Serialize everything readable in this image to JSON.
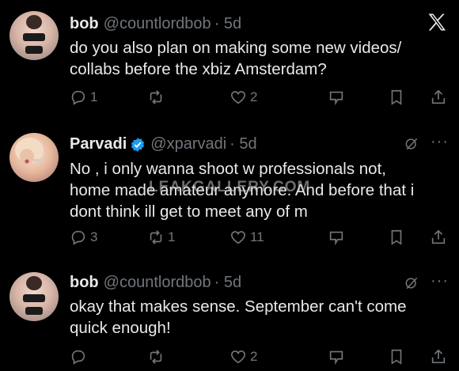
{
  "tweets": [
    {
      "name": "bob",
      "handle": "@countlordbob",
      "time": "· 5d",
      "text_lines": [
        "do you also plan on making some new videos/",
        "collabs before the xbiz Amsterdam?"
      ],
      "replies": "1",
      "retweets": "",
      "likes": "2"
    },
    {
      "name": "Parvadi",
      "handle": "@xparvadi",
      "time": "· 5d",
      "text_lines": [
        "No , i only wanna shoot w professionals not,",
        "home made amateur anymore. And before that i",
        "dont think ill get to meet any of m"
      ],
      "replies": "3",
      "retweets": "1",
      "likes": "11"
    },
    {
      "name": "bob",
      "handle": "@countlordbob",
      "time": "· 5d",
      "text_lines": [
        "okay that makes sense. September can't come",
        "quick enough!"
      ],
      "replies": "",
      "retweets": "",
      "likes": "2"
    }
  ],
  "watermark": "LEAKGALLERY.COM",
  "icons": {
    "logo": "x-logo-icon",
    "reply": "reply-icon",
    "retweet": "retweet-icon",
    "like": "heart-icon",
    "analytics": "analytics-icon",
    "bookmark": "bookmark-icon",
    "share": "share-icon",
    "verified": "verified-badge-icon",
    "more": "more-icon",
    "grok": "grok-icon"
  },
  "colors": {
    "background": "#000000",
    "text": "#e7e9ea",
    "muted": "#71767b",
    "verified": "#1d9bf0"
  }
}
